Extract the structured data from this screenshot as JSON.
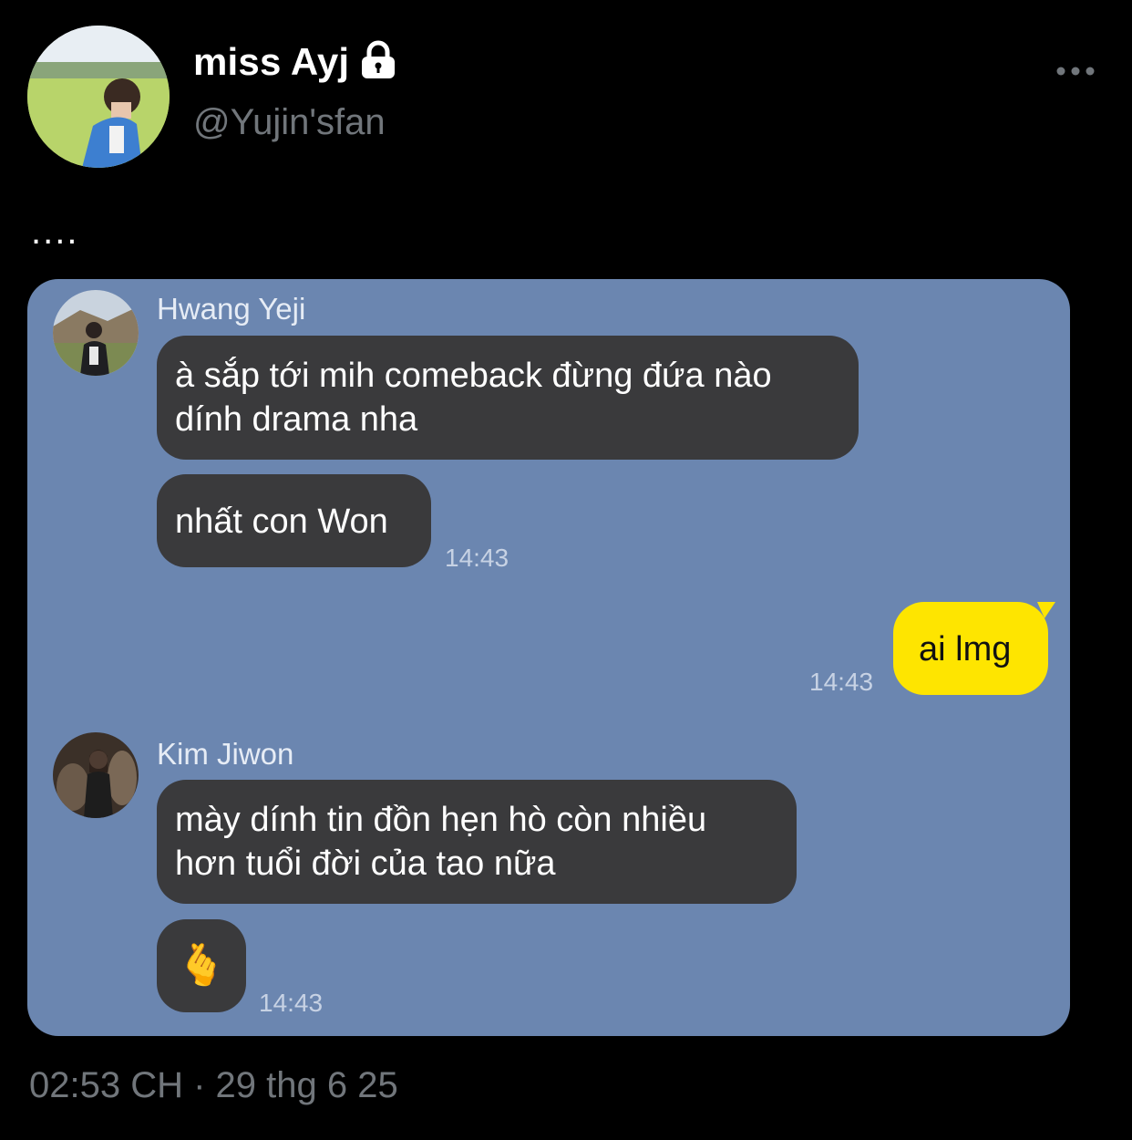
{
  "header": {
    "display_name": "miss Ayj",
    "handle": "@Yujin'sfan",
    "icons": {
      "lock": "lock-icon",
      "more": "more-options-icon"
    }
  },
  "tweet": {
    "text": "...."
  },
  "chat": {
    "background_color": "#6b86b0",
    "messages": [
      {
        "sender": "Hwang Yeji",
        "lines": [
          "à sắp tới mih comeback đừng đứa nào",
          "dính drama nha"
        ]
      },
      {
        "sender": "Hwang Yeji",
        "lines": [
          "nhất con Won"
        ],
        "time": "14:43"
      },
      {
        "sender": "me",
        "lines": [
          "ai lmg"
        ],
        "time": "14:43"
      },
      {
        "sender": "Kim Jiwon",
        "lines": [
          "mày dính tin đồn hẹn hò còn nhiều",
          "hơn tuổi đời của tao nữa"
        ]
      },
      {
        "sender": "Kim Jiwon",
        "emoji": "🫰",
        "time": "14:43"
      }
    ],
    "names": {
      "yeji": "Hwang Yeji",
      "jiwon": "Kim Jiwon"
    }
  },
  "footer": {
    "timestamp": "02:53 CH · 29 thg 6 25"
  },
  "colors": {
    "my_bubble": "#fee500",
    "their_bubble": "#3a3a3c",
    "secondary_text": "#71767b"
  }
}
